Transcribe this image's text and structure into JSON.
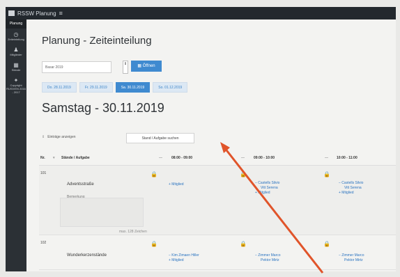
{
  "app": {
    "title": "RSSW Planung",
    "menu_icon": "≡"
  },
  "sidebar": {
    "items": [
      {
        "label": "Planung",
        "icon": "",
        "active": true
      },
      {
        "label": "Zeiteinteilung",
        "icon": "◷"
      },
      {
        "label": "Mitglieder",
        "icon": "♟"
      },
      {
        "label": "Stände",
        "icon": "▦"
      },
      {
        "label": "Copyright RUSIVEN 2016 - 2017",
        "icon": "✦"
      }
    ]
  },
  "page": {
    "title": "Planung - Zeiteinteilung"
  },
  "filter": {
    "date_value": "Basar 2019",
    "stepper_icon": "⇕",
    "open_label": "▦ Öffnen"
  },
  "day_tabs": [
    {
      "label": "Do. 28.11.2019"
    },
    {
      "label": "Fr. 29.11.2019"
    },
    {
      "label": "Sa. 30.11.2019",
      "active": true
    },
    {
      "label": "So. 01.12.2019"
    }
  ],
  "day_heading": "Samstag - 30.11.2019",
  "toolbar": {
    "entries_label": "Einträge anzeigen",
    "search_label": "Stand / Aufgabe suchen"
  },
  "table": {
    "headers": {
      "no": "Nr.",
      "task": "Stände / Aufgabe",
      "slot1": "08:00 - 09:00",
      "slot2": "09:00 - 10:00",
      "slot3": "10:00 - 11:00"
    },
    "rows": [
      {
        "no": "101",
        "task": "Adventsstraße",
        "note_label": "Bemerkung",
        "max_chars": "max. 128 Zeichen",
        "slot1": {
          "add": "+ Mitglied"
        },
        "slot2": {
          "m1": "− Castells Silvio",
          "m2": "Vitt Serena",
          "add": "+ Mitglied"
        },
        "slot3": {
          "m1": "− Castells Silvio",
          "m2": "Vitt Serena",
          "add": "+ Mitglied"
        }
      },
      {
        "no": "102",
        "task": "Wunderkerzenstände",
        "slot1": {
          "m1": "− Kim Zimaen Hiller",
          "add": "+ Mitglied"
        },
        "slot2": {
          "m1": "− Zimmer Marco",
          "m2": "Pektor Mirtz"
        },
        "slot3": {
          "m1": "− Zimmer Marco",
          "m2": "Pektor Mirtz"
        }
      }
    ]
  },
  "colors": {
    "accent": "#3f8ad0",
    "arrow": "#e0542a",
    "sidebar": "#2b3035"
  }
}
